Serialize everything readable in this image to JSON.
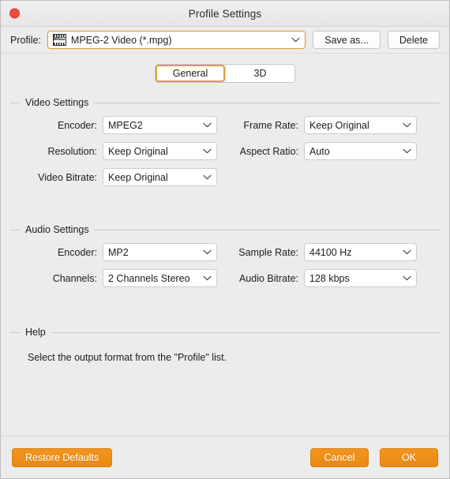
{
  "window": {
    "title": "Profile Settings",
    "close_icon": "close-traffic-light"
  },
  "profile_bar": {
    "label": "Profile:",
    "icon": "mpeg2-film-icon",
    "icon_text": "MPEG2",
    "value": "MPEG-2 Video (*.mpg)",
    "chevron": "chevron-down-icon",
    "save_as_label": "Save as...",
    "delete_label": "Delete"
  },
  "tabs": [
    {
      "label": "General",
      "selected": true
    },
    {
      "label": "3D",
      "selected": false
    }
  ],
  "video_settings": {
    "title": "Video Settings",
    "rows": [
      {
        "left": {
          "label": "Encoder:",
          "value": "MPEG2"
        },
        "right": {
          "label": "Frame Rate:",
          "value": "Keep Original"
        }
      },
      {
        "left": {
          "label": "Resolution:",
          "value": "Keep Original"
        },
        "right": {
          "label": "Aspect Ratio:",
          "value": "Auto"
        }
      },
      {
        "left": {
          "label": "Video Bitrate:",
          "value": "Keep Original"
        },
        "right": {
          "label": "",
          "value": ""
        }
      }
    ]
  },
  "audio_settings": {
    "title": "Audio Settings",
    "rows": [
      {
        "left": {
          "label": "Encoder:",
          "value": "MP2"
        },
        "right": {
          "label": "Sample Rate:",
          "value": "44100 Hz"
        }
      },
      {
        "left": {
          "label": "Channels:",
          "value": "2 Channels Stereo"
        },
        "right": {
          "label": "Audio Bitrate:",
          "value": "128 kbps"
        }
      }
    ]
  },
  "help": {
    "title": "Help",
    "text": "Select the output format from the \"Profile\" list."
  },
  "footer": {
    "restore_label": "Restore Defaults",
    "cancel_label": "Cancel",
    "ok_label": "OK"
  },
  "colors": {
    "accent_orange": "#ef9120",
    "tab_selected_border": "#d9a13a",
    "profile_focus_border": "#d8a33c",
    "close_red": "#f04a3f",
    "window_bg": "#ececec"
  }
}
